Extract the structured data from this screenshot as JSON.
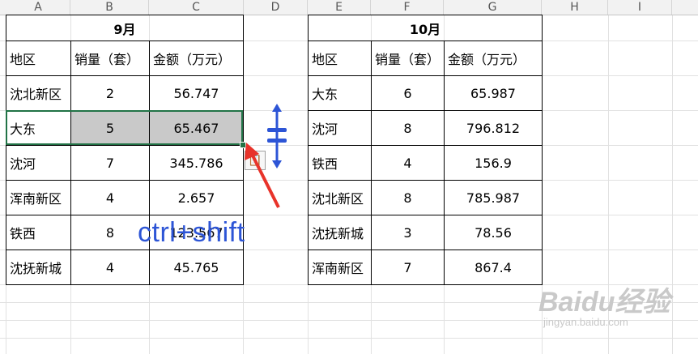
{
  "columns": [
    "A",
    "B",
    "C",
    "D",
    "E",
    "F",
    "G",
    "H",
    "I"
  ],
  "table1": {
    "title": "9月",
    "headers": [
      "地区",
      "销量（套）",
      "金额（万元）"
    ],
    "rows": [
      [
        "沈北新区",
        "2",
        "56.747"
      ],
      [
        "大东",
        "5",
        "65.467"
      ],
      [
        "沈河",
        "7",
        "345.786"
      ],
      [
        "浑南新区",
        "4",
        "2.657"
      ],
      [
        "铁西",
        "8",
        "123.567"
      ],
      [
        "沈抚新城",
        "4",
        "45.765"
      ]
    ]
  },
  "table2": {
    "title": "10月",
    "headers": [
      "地区",
      "销量（套）",
      "金额（万元）"
    ],
    "rows": [
      [
        "大东",
        "6",
        "65.987"
      ],
      [
        "沈河",
        "8",
        "796.812"
      ],
      [
        "铁西",
        "4",
        "156.9"
      ],
      [
        "沈北新区",
        "8",
        "785.987"
      ],
      [
        "沈抚新城",
        "3",
        "78.56"
      ],
      [
        "浑南新区",
        "7",
        "867.4"
      ]
    ]
  },
  "overlay": {
    "shortcut_text": "ctrl+shift",
    "accent_color": "#2d55d6",
    "arrow_color": "#e8332a",
    "paste_icon": "paste-options-icon",
    "resize_icon": "row-height-resize-icon"
  },
  "watermark": {
    "brand": "Baidu经验",
    "url": "jingyan.baidu.com"
  }
}
